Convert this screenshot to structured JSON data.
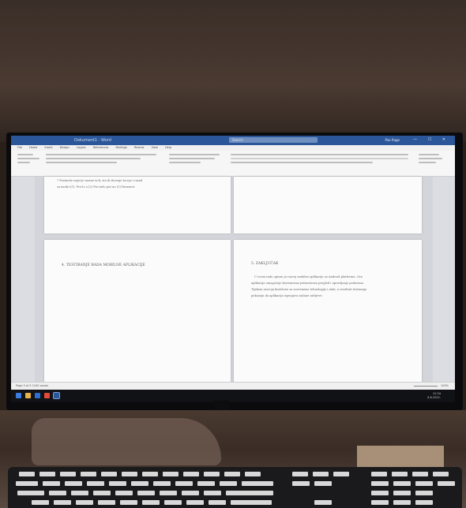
{
  "window": {
    "doc_title": "Dokument1 - Word",
    "search_placeholder": "Search",
    "user": "Pao Rago",
    "buttons": "— ☐ ✕"
  },
  "tabs": [
    "File",
    "Home",
    "Insert",
    "Design",
    "Layout",
    "References",
    "Mailings",
    "Review",
    "View",
    "Help"
  ],
  "pages": {
    "page1_lines": [
      "7 Postavite najvi-je razine ta-k, sta ili shvenje ho-nje i rasad",
      "sa mode i(1). Pro-lo o.(2) Pro-nelo poi izo (3) Paraznot."
    ],
    "page3_heading": "4. TESTIRANJE RADA MOBILNE APLIKACIJE",
    "page4_heading": "5. ZAKLJUČAK",
    "page4_lines": [
      "U ovom radu opisan je razvoj mobilne aplikacije za Android platformu. Ova",
      "aplikacija omogućuje korisnicima jednostavan pregled i upravljanje podacima.",
      "Tijekom razvoja korištene su suvremene tehnologije i alati, a rezultati testiranja",
      "pokazuju da aplikacija ispunjava zadane zahtjeve."
    ]
  },
  "statusbar": {
    "left": "Page 5 of 5   1240 words",
    "right": "100%"
  },
  "taskbar": {
    "time": "12:34",
    "date": "8.6.2022."
  },
  "colors": {
    "titlebar": "#2b579a",
    "taskbar": "#101216"
  }
}
